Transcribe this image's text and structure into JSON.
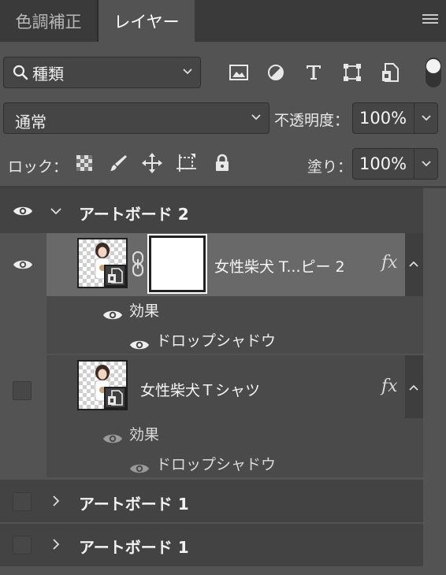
{
  "tabs": [
    {
      "label": "色調補正",
      "active": false
    },
    {
      "label": "レイヤー",
      "active": true
    }
  ],
  "filter": {
    "label": "種類",
    "icons": [
      "image-filter-icon",
      "adjustment-filter-icon",
      "type-filter-icon",
      "shape-filter-icon",
      "smart-object-filter-icon"
    ]
  },
  "blend": {
    "mode": "通常",
    "opacity_label": "不透明度：",
    "opacity": "100%"
  },
  "lock": {
    "label": "ロック：",
    "fill_label": "塗り：",
    "fill": "100%"
  },
  "layers": {
    "artboard2": {
      "name": "アートボード 2",
      "expanded": true
    },
    "layer1": {
      "name": "女性柴犬 T...ピー 2",
      "fx": "fx",
      "effects_label": "効果",
      "effect": "ドロップシャドウ",
      "visible": true,
      "selected": true
    },
    "layer2": {
      "name": "女性柴犬Ｔシャツ",
      "fx": "fx",
      "effects_label": "効果",
      "effect": "ドロップシャドウ",
      "visible": false
    },
    "artboard1a": {
      "name": "アートボード 1",
      "expanded": false
    },
    "artboard1b": {
      "name": "アートボード 1",
      "expanded": false
    }
  },
  "colors": {
    "panel": "#535353",
    "selected_row": "#696969",
    "text": "#f2f2f2"
  }
}
